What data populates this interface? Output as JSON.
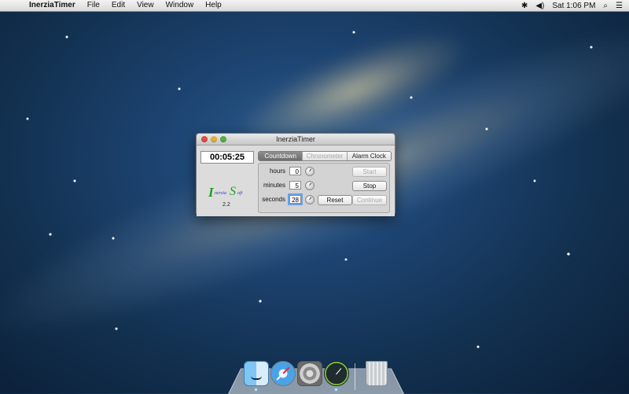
{
  "menubar": {
    "apple_glyph": "",
    "app_name": "InerziaTimer",
    "items": [
      "File",
      "Edit",
      "View",
      "Window",
      "Help"
    ],
    "status": {
      "bluetooth_glyph": "✱",
      "volume_glyph": "◀)",
      "clock": "Sat 1:06 PM",
      "search_glyph": "⌕",
      "list_glyph": "☰"
    }
  },
  "window": {
    "title": "InerziaTimer",
    "time_display": "00:05:25",
    "logo": {
      "first_letter": "I",
      "first_word": "nerzia",
      "second_letter": "S",
      "second_word": "oft"
    },
    "version": "2.2",
    "tabs": [
      {
        "label": "Countdown",
        "state": "selected"
      },
      {
        "label": "Chronometer",
        "state": "disabled"
      },
      {
        "label": "Alarm Clock",
        "state": "normal"
      }
    ],
    "fields": {
      "hours": {
        "label": "hours",
        "value": "0"
      },
      "minutes": {
        "label": "minutes",
        "value": "5"
      },
      "seconds": {
        "label": "seconds",
        "value": "28"
      }
    },
    "buttons": {
      "start": "Start",
      "stop": "Stop",
      "reset": "Reset",
      "continue": "Continue"
    }
  },
  "dock": {
    "apps": [
      "finder-icon",
      "safari-icon",
      "system-preferences-icon",
      "inerziatimer-icon",
      "trash-icon"
    ]
  }
}
